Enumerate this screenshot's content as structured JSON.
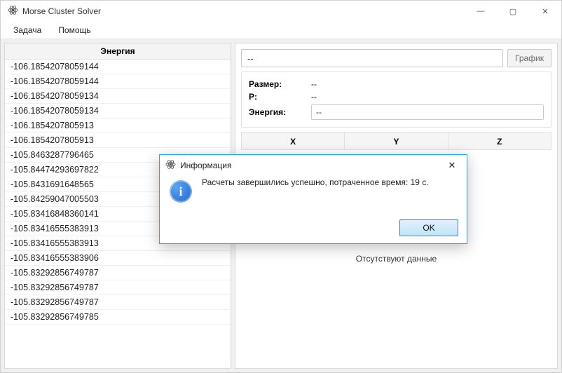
{
  "window": {
    "title": "Morse Cluster Solver",
    "minimize_glyph": "—",
    "maximize_glyph": "▢",
    "close_glyph": "✕"
  },
  "menu": {
    "task": "Задача",
    "help": "Помощь"
  },
  "left": {
    "header": "Энергия",
    "rows": [
      "-106.18542078059144",
      "-106.18542078059144",
      "-106.18542078059134",
      "-106.18542078059134",
      "-106.1854207805913",
      "-106.1854207805913",
      "-105.8463287796465",
      "-105.84474293697822",
      "-105.8431691648565",
      "-105.84259047005503",
      "-105.83416848360141",
      "-105.83416555383913",
      "-105.83416555383913",
      "-105.83416555383906",
      "-105.83292856749787",
      "-105.83292856749787",
      "-105.83292856749787",
      "-105.83292856749785"
    ]
  },
  "right": {
    "top_input_value": "--",
    "graph_button": "График",
    "size_label": "Размер:",
    "size_value": "--",
    "p_label": "P:",
    "p_value": "--",
    "energy_label": "Энергия:",
    "energy_value": "--",
    "col_x": "X",
    "col_y": "Y",
    "col_z": "Z",
    "no_data": "Отсутствуют данные"
  },
  "dialog": {
    "title": "Информация",
    "close_glyph": "✕",
    "info_glyph": "i",
    "message": "Расчеты завершились успешно, потраченное время: 19 с.",
    "ok": "OK"
  }
}
